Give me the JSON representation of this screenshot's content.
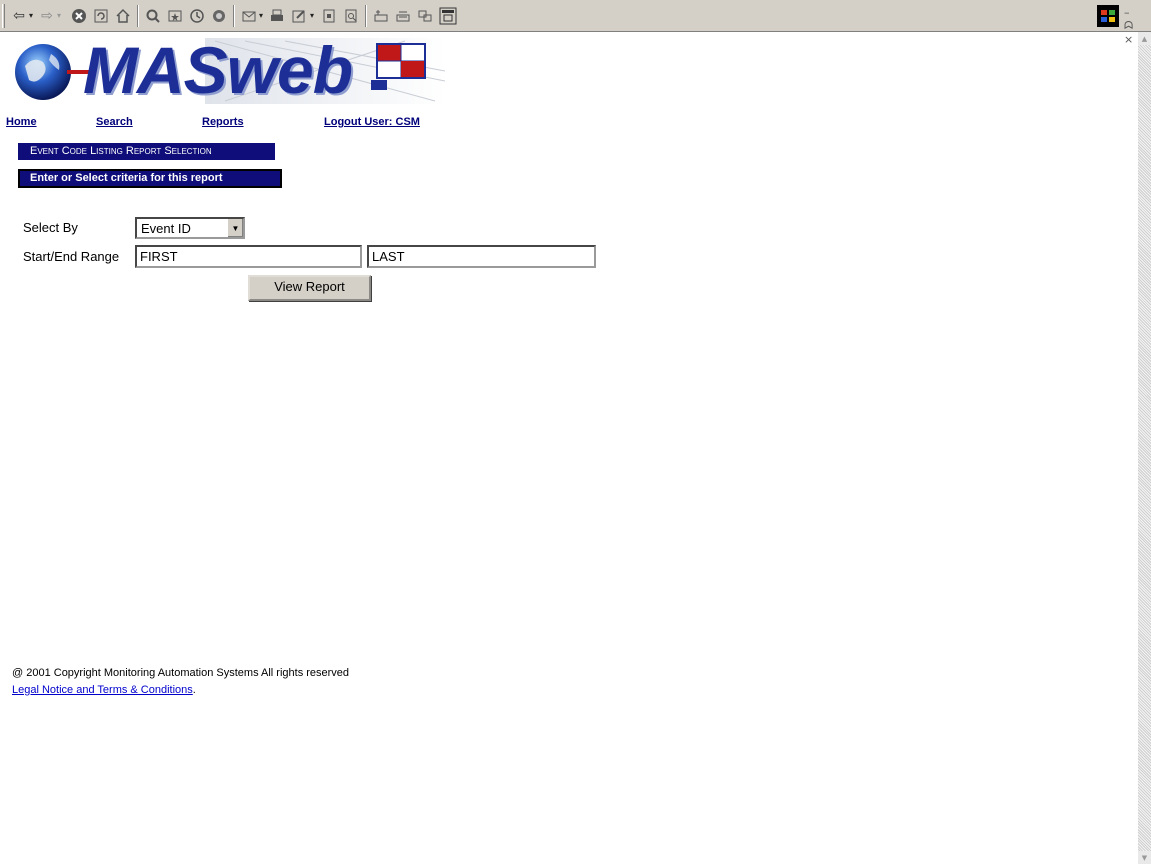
{
  "toolbar": {
    "back": "⇦",
    "forward": "⇨",
    "dropdown": "▾",
    "icons": [
      "back-icon",
      "forward-icon",
      "stop-icon",
      "refresh-icon",
      "home-icon",
      "search-icon",
      "favorites-icon",
      "history-icon",
      "channels-icon",
      "mail-icon",
      "print-icon",
      "edit-icon",
      "discuss-icon",
      "preview-icon",
      "toolbar-icon-1",
      "toolbar-icon-2",
      "toolbar-icon-3",
      "fullscreen-icon"
    ],
    "window_controls": "– ᗣ ×"
  },
  "logo": {
    "text": "MASweb"
  },
  "nav": {
    "home": "Home",
    "search": "Search",
    "reports": "Reports",
    "logout": "Logout User: CSM"
  },
  "banner": {
    "title": "Event Code Listing Report Selection",
    "subtitle": "Enter or Select criteria for this report"
  },
  "form": {
    "select_by_label": "Select By",
    "select_by_value": "Event ID",
    "range_label": "Start/End Range",
    "start_value": "FIRST",
    "end_value": "LAST",
    "submit_label": "View Report"
  },
  "footer": {
    "copyright": "@ 2001 Copyright Monitoring Automation Systems All rights reserved",
    "legal_link": "Legal Notice and Terms & Conditions",
    "legal_suffix": "."
  },
  "colors": {
    "banner": "#0e0d79",
    "nav_link": "#00007a",
    "logo_text": "#1d2f97",
    "toolbar_bg": "#d4d0c8"
  }
}
